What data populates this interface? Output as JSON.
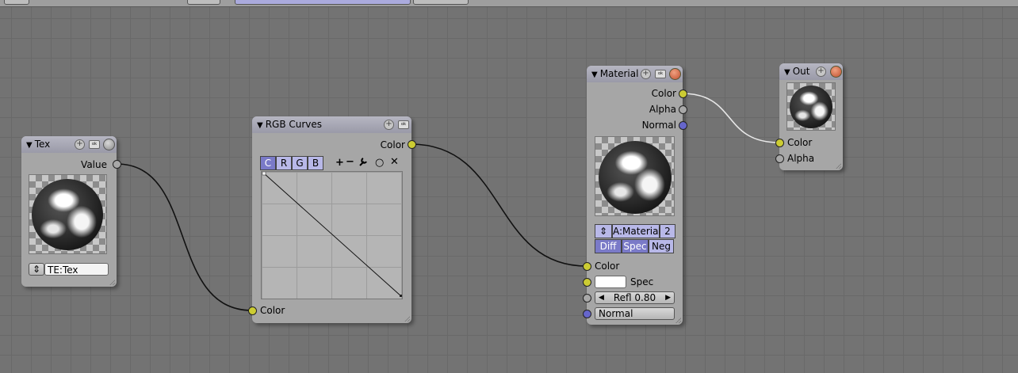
{
  "colors": {
    "socket_color": "#cccc33",
    "socket_float": "#a8a8a8",
    "socket_vector": "#6666cc",
    "button_blue": "#b8b8e8",
    "button_dark": "#7a7ac8"
  },
  "nodes": {
    "tex": {
      "title": "Tex",
      "output": "Value",
      "texture_field": "TE:Tex"
    },
    "rgb_curves": {
      "title": "RGB Curves",
      "output": "Color",
      "input": "Color",
      "channels": [
        "C",
        "R",
        "G",
        "B"
      ],
      "tools": {
        "zoom_in": "+",
        "zoom_out": "−",
        "wrench": "wrench-icon",
        "clip": "○",
        "delete": "✕"
      }
    },
    "material": {
      "title": "Material",
      "outputs": [
        "Color",
        "Alpha",
        "Normal"
      ],
      "material_field": "A:Material",
      "users": "2",
      "toggles": [
        "Diff",
        "Spec",
        "Neg"
      ],
      "inputs": {
        "color": "Color",
        "spec": "Spec",
        "refl": "Refl 0.80",
        "normal": "Normal"
      }
    },
    "output": {
      "title": "Out",
      "inputs": [
        "Color",
        "Alpha"
      ]
    }
  }
}
